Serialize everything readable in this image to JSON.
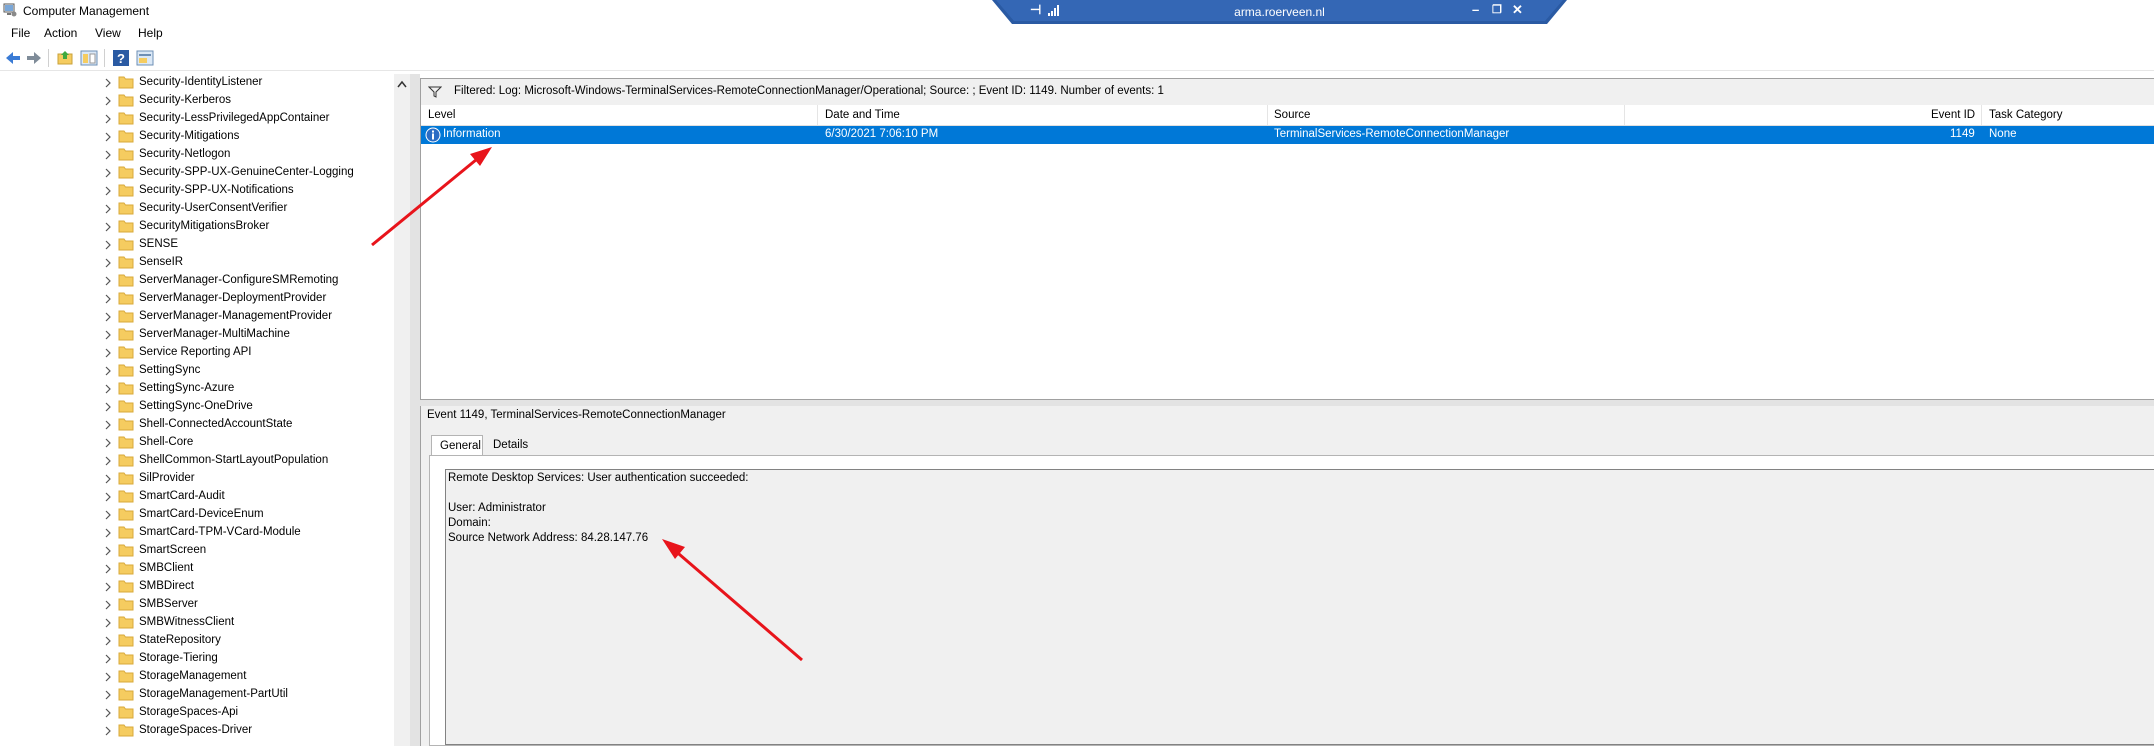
{
  "window": {
    "title": "Computer Management"
  },
  "rdp_bar": {
    "host": "arma.roerveen.nl"
  },
  "menu": [
    "File",
    "Action",
    "View",
    "Help"
  ],
  "toolbar": {
    "icons": [
      "back-arrow-icon",
      "forward-arrow-icon",
      "up-folder-icon",
      "show-hide-console-tree-icon",
      "help-icon",
      "properties-icon"
    ]
  },
  "tree": {
    "items": [
      "Security-IdentityListener",
      "Security-Kerberos",
      "Security-LessPrivilegedAppContainer",
      "Security-Mitigations",
      "Security-Netlogon",
      "Security-SPP-UX-GenuineCenter-Logging",
      "Security-SPP-UX-Notifications",
      "Security-UserConsentVerifier",
      "SecurityMitigationsBroker",
      "SENSE",
      "SenseIR",
      "ServerManager-ConfigureSMRemoting",
      "ServerManager-DeploymentProvider",
      "ServerManager-ManagementProvider",
      "ServerManager-MultiMachine",
      "Service Reporting API",
      "SettingSync",
      "SettingSync-Azure",
      "SettingSync-OneDrive",
      "Shell-ConnectedAccountState",
      "Shell-Core",
      "ShellCommon-StartLayoutPopulation",
      "SilProvider",
      "SmartCard-Audit",
      "SmartCard-DeviceEnum",
      "SmartCard-TPM-VCard-Module",
      "SmartScreen",
      "SMBClient",
      "SMBDirect",
      "SMBServer",
      "SMBWitnessClient",
      "StateRepository",
      "Storage-Tiering",
      "StorageManagement",
      "StorageManagement-PartUtil",
      "StorageSpaces-Api",
      "StorageSpaces-Driver"
    ]
  },
  "filter": {
    "text": "Filtered: Log: Microsoft-Windows-TerminalServices-RemoteConnectionManager/Operational; Source: ; Event ID: 1149. Number of events: 1"
  },
  "columns": {
    "level": "Level",
    "date": "Date and Time",
    "source": "Source",
    "event_id": "Event ID",
    "task": "Task Category"
  },
  "event": {
    "level": "Information",
    "date": "6/30/2021 7:06:10 PM",
    "source": "TerminalServices-RemoteConnectionManager",
    "event_id": "1149",
    "task": "None"
  },
  "details": {
    "title": "Event 1149, TerminalServices-RemoteConnectionManager",
    "tabs": {
      "general": "General",
      "details": "Details"
    },
    "lines": [
      "Remote Desktop Services: User authentication succeeded:",
      "User: Administrator",
      "Domain:",
      "Source Network Address: 84.28.147.76"
    ]
  },
  "colors": {
    "selection": "#0078d7",
    "rdp_bar": "#2a5aa3",
    "annotation_arrow": "#e8141b",
    "folder": "#f5cc60"
  }
}
